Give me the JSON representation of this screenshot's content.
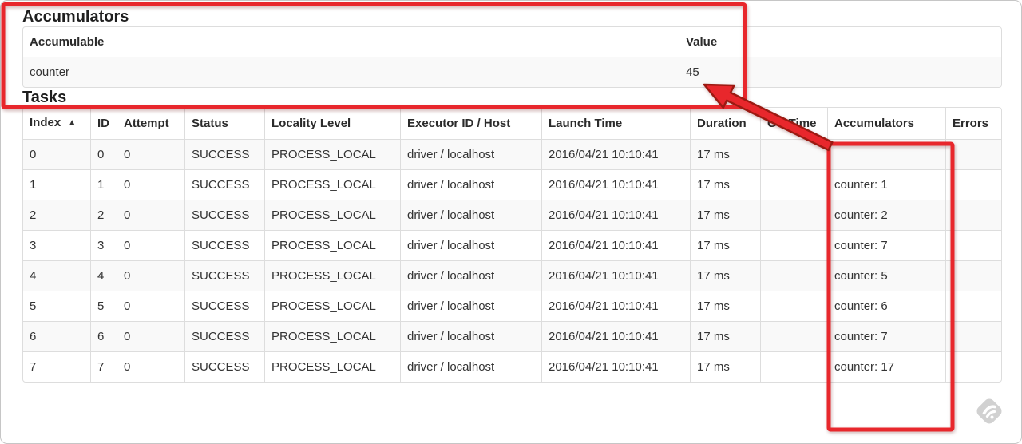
{
  "accumulators_section": {
    "title": "Accumulators",
    "table": {
      "headers": [
        "Accumulable",
        "Value"
      ],
      "rows": [
        [
          "counter",
          "45"
        ]
      ]
    }
  },
  "tasks_section": {
    "title": "Tasks",
    "table": {
      "headers": [
        "Index",
        "ID",
        "Attempt",
        "Status",
        "Locality Level",
        "Executor ID / Host",
        "Launch Time",
        "Duration",
        "GC Time",
        "Accumulators",
        "Errors"
      ],
      "sort": {
        "column_index": 0,
        "icon": "▲",
        "direction": "ascending"
      },
      "rows": [
        [
          "0",
          "0",
          "0",
          "SUCCESS",
          "PROCESS_LOCAL",
          "driver / localhost",
          "2016/04/21 10:10:41",
          "17 ms",
          "",
          "",
          ""
        ],
        [
          "1",
          "1",
          "0",
          "SUCCESS",
          "PROCESS_LOCAL",
          "driver / localhost",
          "2016/04/21 10:10:41",
          "17 ms",
          "",
          "counter: 1",
          ""
        ],
        [
          "2",
          "2",
          "0",
          "SUCCESS",
          "PROCESS_LOCAL",
          "driver / localhost",
          "2016/04/21 10:10:41",
          "17 ms",
          "",
          "counter: 2",
          ""
        ],
        [
          "3",
          "3",
          "0",
          "SUCCESS",
          "PROCESS_LOCAL",
          "driver / localhost",
          "2016/04/21 10:10:41",
          "17 ms",
          "",
          "counter: 7",
          ""
        ],
        [
          "4",
          "4",
          "0",
          "SUCCESS",
          "PROCESS_LOCAL",
          "driver / localhost",
          "2016/04/21 10:10:41",
          "17 ms",
          "",
          "counter: 5",
          ""
        ],
        [
          "5",
          "5",
          "0",
          "SUCCESS",
          "PROCESS_LOCAL",
          "driver / localhost",
          "2016/04/21 10:10:41",
          "17 ms",
          "",
          "counter: 6",
          ""
        ],
        [
          "6",
          "6",
          "0",
          "SUCCESS",
          "PROCESS_LOCAL",
          "driver / localhost",
          "2016/04/21 10:10:41",
          "17 ms",
          "",
          "counter: 7",
          ""
        ],
        [
          "7",
          "7",
          "0",
          "SUCCESS",
          "PROCESS_LOCAL",
          "driver / localhost",
          "2016/04/21 10:10:41",
          "17 ms",
          "",
          "counter: 17",
          ""
        ]
      ]
    }
  },
  "annotations": {
    "color": "#e8272c",
    "arrow_outline_color": "#9b1a12",
    "highlighted_value": "45",
    "highlighted_column": "Accumulators"
  },
  "watermark": {
    "name": "skitch-watermark",
    "color": "#c9c9c9",
    "mark_color": "#ffffff"
  }
}
